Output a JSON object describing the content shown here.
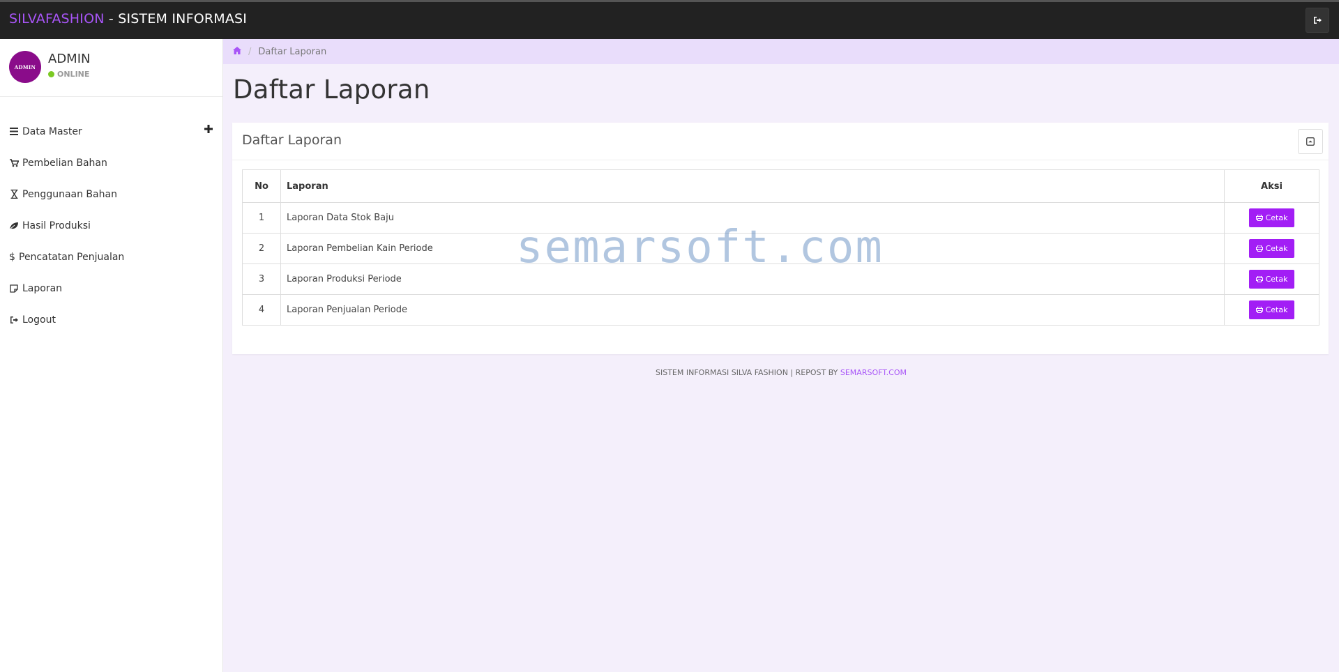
{
  "app": {
    "brand_accent": "SILVAFASHION",
    "brand_rest": " - SISTEM INFORMASI",
    "logout_icon": "sign-out-icon"
  },
  "user": {
    "avatar_text": "ADMIN",
    "name": "ADMIN",
    "status": "ONLINE"
  },
  "sidebar": {
    "items": [
      {
        "label": "Data Master",
        "icon": "bars-icon"
      },
      {
        "label": "Pembelian Bahan",
        "icon": "cart-icon"
      },
      {
        "label": "Penggunaan Bahan",
        "icon": "hourglass-icon"
      },
      {
        "label": "Hasil Produksi",
        "icon": "leaf-icon"
      },
      {
        "label": "Pencatatan Penjualan",
        "icon": "dollar-icon"
      },
      {
        "label": "Laporan",
        "icon": "note-icon"
      },
      {
        "label": "Logout",
        "icon": "sign-out-icon"
      }
    ]
  },
  "breadcrumb": {
    "current": "Daftar Laporan"
  },
  "page": {
    "title": "Daftar Laporan"
  },
  "card": {
    "title": "Daftar Laporan",
    "table": {
      "headers": {
        "no": "No",
        "laporan": "Laporan",
        "aksi": "Aksi"
      },
      "rows": [
        {
          "no": "1",
          "laporan": "Laporan Data Stok Baju",
          "action": "Cetak"
        },
        {
          "no": "2",
          "laporan": "Laporan Pembelian Kain Periode",
          "action": "Cetak"
        },
        {
          "no": "3",
          "laporan": "Laporan Produksi Periode",
          "action": "Cetak"
        },
        {
          "no": "4",
          "laporan": "Laporan Penjualan Periode",
          "action": "Cetak"
        }
      ]
    }
  },
  "footer": {
    "text": "SISTEM INFORMASI SILVA FASHION | REPOST BY ",
    "link": "SEMARSOFT.COM"
  },
  "watermark": "semarsoft.com",
  "colors": {
    "accent": "#a855f7",
    "button": "#a21ef5",
    "topbar": "#222222",
    "breadcrumb_bg": "#e9ddfb",
    "content_bg": "#f4effb",
    "online": "#7bc923"
  }
}
